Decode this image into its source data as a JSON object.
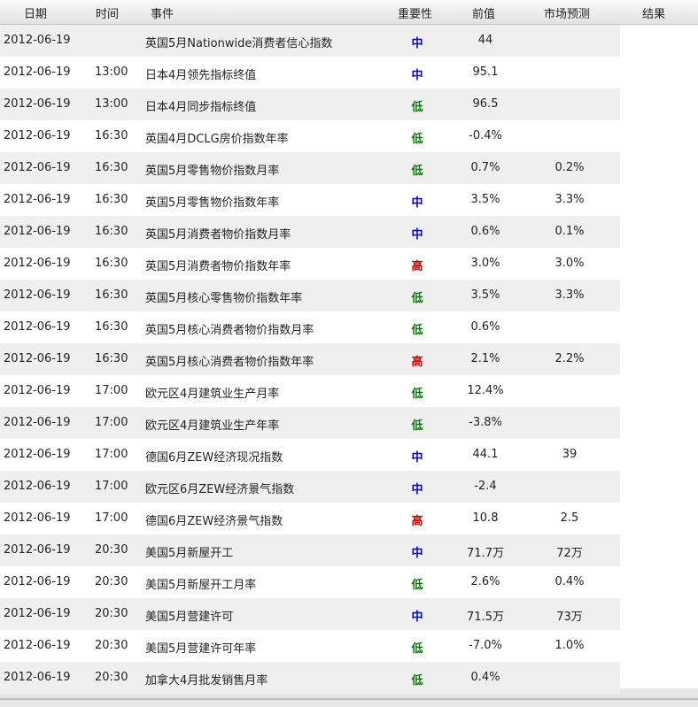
{
  "headers": {
    "date": "日期",
    "time": "时间",
    "event": "事件",
    "importance": "重要性",
    "previous": "前值",
    "forecast": "市场预测",
    "result": "结果"
  },
  "importance_colors": {
    "中": "#0000cc",
    "低": "#008000",
    "高": "#cc0000"
  },
  "rows": [
    {
      "date": "2012-06-19",
      "time": "",
      "event": "英国5月Nationwide消费者信心指数",
      "importance": "中",
      "previous": "44",
      "forecast": "",
      "result": ""
    },
    {
      "date": "2012-06-19",
      "time": "13:00",
      "event": "日本4月领先指标终值",
      "importance": "中",
      "previous": "95.1",
      "forecast": "",
      "result": ""
    },
    {
      "date": "2012-06-19",
      "time": "13:00",
      "event": "日本4月同步指标终值",
      "importance": "低",
      "previous": "96.5",
      "forecast": "",
      "result": ""
    },
    {
      "date": "2012-06-19",
      "time": "16:30",
      "event": "英国4月DCLG房价指数年率",
      "importance": "低",
      "previous": "-0.4%",
      "forecast": "",
      "result": ""
    },
    {
      "date": "2012-06-19",
      "time": "16:30",
      "event": "英国5月零售物价指数月率",
      "importance": "低",
      "previous": "0.7%",
      "forecast": "0.2%",
      "result": ""
    },
    {
      "date": "2012-06-19",
      "time": "16:30",
      "event": "英国5月零售物价指数年率",
      "importance": "中",
      "previous": "3.5%",
      "forecast": "3.3%",
      "result": ""
    },
    {
      "date": "2012-06-19",
      "time": "16:30",
      "event": "英国5月消费者物价指数月率",
      "importance": "中",
      "previous": "0.6%",
      "forecast": "0.1%",
      "result": ""
    },
    {
      "date": "2012-06-19",
      "time": "16:30",
      "event": "英国5月消费者物价指数年率",
      "importance": "高",
      "previous": "3.0%",
      "forecast": "3.0%",
      "result": ""
    },
    {
      "date": "2012-06-19",
      "time": "16:30",
      "event": "英国5月核心零售物价指数年率",
      "importance": "低",
      "previous": "3.5%",
      "forecast": "3.3%",
      "result": ""
    },
    {
      "date": "2012-06-19",
      "time": "16:30",
      "event": "英国5月核心消费者物价指数月率",
      "importance": "低",
      "previous": "0.6%",
      "forecast": "",
      "result": ""
    },
    {
      "date": "2012-06-19",
      "time": "16:30",
      "event": "英国5月核心消费者物价指数年率",
      "importance": "高",
      "previous": "2.1%",
      "forecast": "2.2%",
      "result": ""
    },
    {
      "date": "2012-06-19",
      "time": "17:00",
      "event": "欧元区4月建筑业生产月率",
      "importance": "低",
      "previous": "12.4%",
      "forecast": "",
      "result": ""
    },
    {
      "date": "2012-06-19",
      "time": "17:00",
      "event": "欧元区4月建筑业生产年率",
      "importance": "低",
      "previous": "-3.8%",
      "forecast": "",
      "result": ""
    },
    {
      "date": "2012-06-19",
      "time": "17:00",
      "event": "德国6月ZEW经济现况指数",
      "importance": "中",
      "previous": "44.1",
      "forecast": "39",
      "result": ""
    },
    {
      "date": "2012-06-19",
      "time": "17:00",
      "event": "欧元区6月ZEW经济景气指数",
      "importance": "中",
      "previous": "-2.4",
      "forecast": "",
      "result": ""
    },
    {
      "date": "2012-06-19",
      "time": "17:00",
      "event": "德国6月ZEW经济景气指数",
      "importance": "高",
      "previous": "10.8",
      "forecast": "2.5",
      "result": ""
    },
    {
      "date": "2012-06-19",
      "time": "20:30",
      "event": "美国5月新屋开工",
      "importance": "中",
      "previous": "71.7万",
      "forecast": "72万",
      "result": ""
    },
    {
      "date": "2012-06-19",
      "time": "20:30",
      "event": "美国5月新屋开工月率",
      "importance": "低",
      "previous": "2.6%",
      "forecast": "0.4%",
      "result": ""
    },
    {
      "date": "2012-06-19",
      "time": "20:30",
      "event": "美国5月营建许可",
      "importance": "中",
      "previous": "71.5万",
      "forecast": "73万",
      "result": ""
    },
    {
      "date": "2012-06-19",
      "time": "20:30",
      "event": "美国5月营建许可年率",
      "importance": "低",
      "previous": "-7.0%",
      "forecast": "1.0%",
      "result": ""
    },
    {
      "date": "2012-06-19",
      "time": "20:30",
      "event": "加拿大4月批发销售月率",
      "importance": "低",
      "previous": "0.4%",
      "forecast": "",
      "result": ""
    }
  ]
}
